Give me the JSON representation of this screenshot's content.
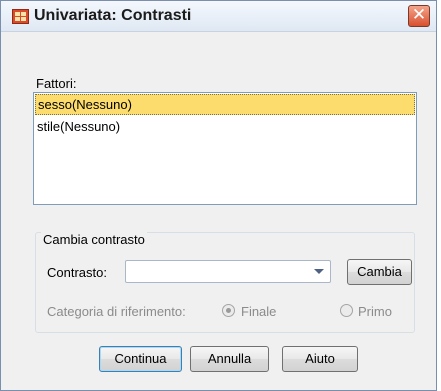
{
  "window": {
    "title": "Univariata: Contrasti",
    "close_glyph": "✕",
    "app_icon": "table-grid-icon"
  },
  "factors": {
    "label": "Fattori:",
    "items": [
      {
        "label": "sesso(Nessuno)",
        "selected": true
      },
      {
        "label": "stile(Nessuno)",
        "selected": false
      }
    ]
  },
  "change_contrast": {
    "group_label": "Cambia contrasto",
    "contrast_label": "Contrasto:",
    "contrast_value": "",
    "change_button": "Cambia",
    "reference_label": "Categoria di riferimento:",
    "options": [
      {
        "label": "Finale",
        "checked": true,
        "enabled": false
      },
      {
        "label": "Primo",
        "checked": false,
        "enabled": false
      }
    ]
  },
  "footer": {
    "continue_button": "Continua",
    "cancel_button": "Annulla",
    "help_button": "Aiuto"
  },
  "colors": {
    "selection": "#fcdc6c",
    "default_button_border": "#3c7fb1",
    "close_button": "#d8502e"
  }
}
